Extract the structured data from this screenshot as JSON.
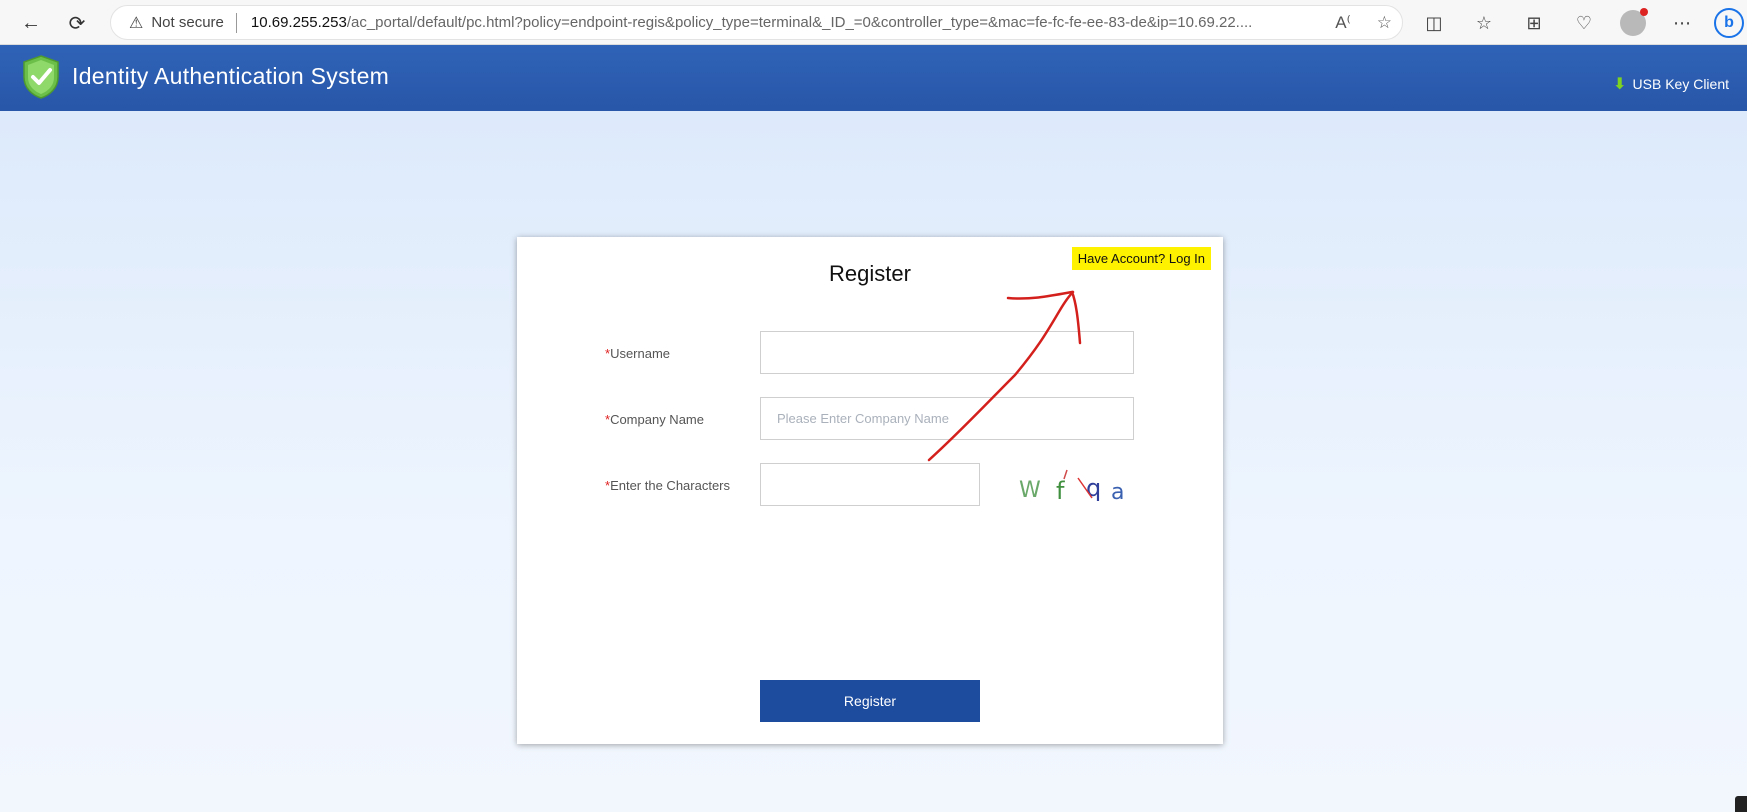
{
  "browser": {
    "security_label": "Not secure",
    "url_host": "10.69.255.253",
    "url_path": "/ac_portal/default/pc.html?policy=endpoint-regis&policy_type=terminal&_ID_=0&controller_type=&mac=fe-fc-fe-ee-83-de&ip=10.69.22...."
  },
  "header": {
    "title": "Identity Authentication System",
    "usb_link": "USB Key Client",
    "accent_color": "#2f63b7",
    "usb_icon_color": "#7ed321"
  },
  "form": {
    "title": "Register",
    "login_link": "Have Account? Log In",
    "fields": [
      {
        "required_mark": "*",
        "label": "Username",
        "value": "",
        "placeholder": ""
      },
      {
        "required_mark": "*",
        "label": "Company Name",
        "value": "",
        "placeholder": "Please Enter Company Name"
      },
      {
        "required_mark": "*",
        "label": "Enter the Characters",
        "value": "",
        "placeholder": ""
      }
    ],
    "captcha": [
      "W",
      "f",
      "q",
      "a"
    ],
    "submit_label": "Register",
    "submit_color": "#1d4b9e"
  }
}
